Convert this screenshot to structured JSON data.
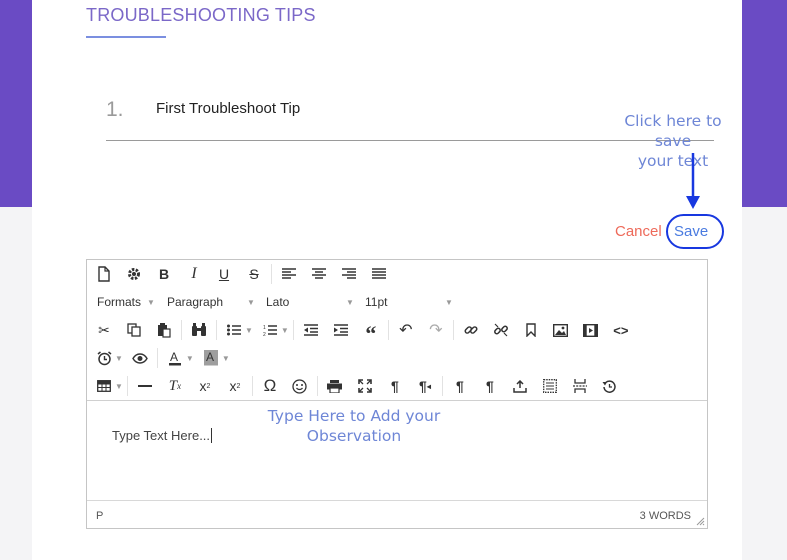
{
  "section": {
    "title": "TROUBLESHOOTING TIPS"
  },
  "tip": {
    "number": "1.",
    "text": "First Troubleshoot Tip"
  },
  "annotations": {
    "save_hint_line1": "Click here to save",
    "save_hint_line2": "your text",
    "type_hint_line1": "Type Here to Add your",
    "type_hint_line2": "Observation"
  },
  "actions": {
    "cancel_label": "Cancel",
    "save_label": "Save"
  },
  "toolbar": {
    "row1_icons": [
      "new-document-icon",
      "settings-icon",
      "bold-icon",
      "italic-icon",
      "underline-icon",
      "strikethrough-icon",
      "align-left-icon",
      "align-center-icon",
      "align-right-icon",
      "align-justify-icon"
    ],
    "formats_label": "Formats",
    "block_label": "Paragraph",
    "font_label": "Lato",
    "size_label": "11pt",
    "row3_icons": [
      "cut-icon",
      "copy-icon",
      "paste-icon",
      "find-replace-icon",
      "bullet-list-icon",
      "numbered-list-icon",
      "outdent-icon",
      "indent-icon",
      "blockquote-icon",
      "undo-icon",
      "redo-icon",
      "link-icon",
      "unlink-icon",
      "bookmark-icon",
      "image-icon",
      "media-icon",
      "source-code-icon"
    ],
    "row4_icons": [
      "insert-time-icon",
      "preview-icon",
      "text-color-icon",
      "background-color-icon"
    ],
    "row5_icons": [
      "table-icon",
      "horizontal-rule-icon",
      "clear-formatting-icon",
      "subscript-icon",
      "superscript-icon",
      "special-character-icon",
      "emoticons-icon",
      "print-icon",
      "fullscreen-icon",
      "ltr-icon",
      "rtl-icon",
      "show-blocks-icon",
      "nonbreaking-icon",
      "upload-icon",
      "template-icon",
      "page-break-icon",
      "restore-draft-icon"
    ],
    "text_color": "#333333",
    "background_color": "#9e9e9e"
  },
  "editor": {
    "content": "Type Text Here...",
    "path": "P",
    "word_count": "3 WORDS"
  },
  "colors": {
    "header_bg": "#6a4bc4",
    "accent": "#7b68c8",
    "annotation": "#6e86d6",
    "arrow": "#1838e0",
    "cancel": "#ee6a5a",
    "save": "#4a7be0"
  }
}
